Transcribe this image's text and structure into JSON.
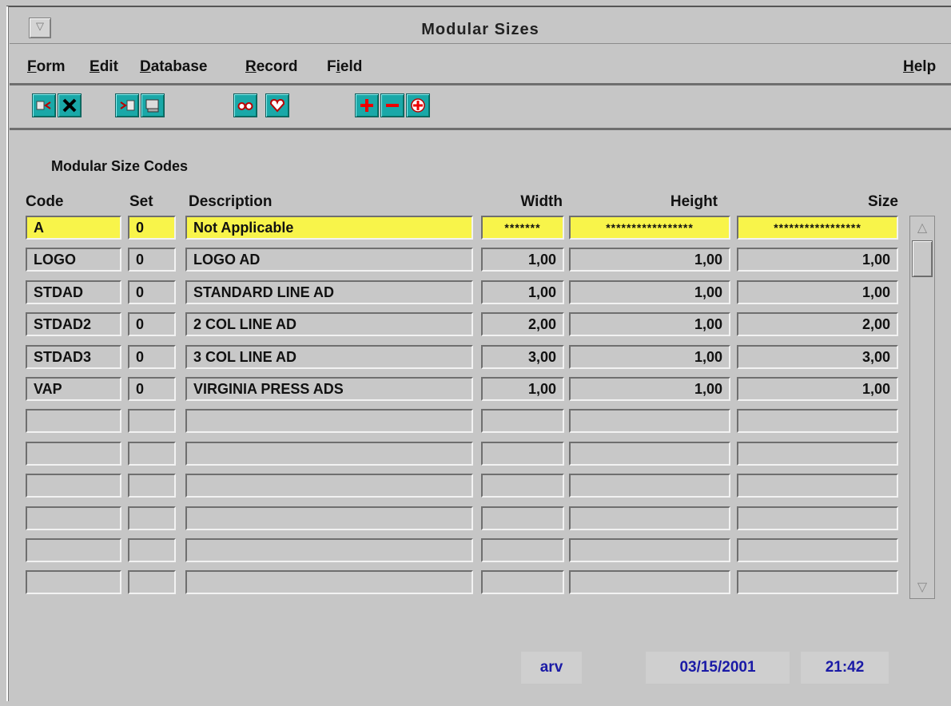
{
  "window": {
    "title": "Modular Sizes",
    "system_menu_glyph": "▽"
  },
  "menubar": {
    "items": [
      {
        "mnemonic": "F",
        "rest": "orm"
      },
      {
        "mnemonic": "E",
        "rest": "dit"
      },
      {
        "mnemonic": "D",
        "rest": "atabase"
      },
      {
        "mnemonic": "R",
        "rest": "ecord"
      },
      {
        "lead": "F",
        "mnemonic": "i",
        "rest": "eld"
      },
      {
        "mnemonic": "H",
        "rest": "elp"
      }
    ]
  },
  "toolbar": {
    "buttons": [
      {
        "icon": "enter-query-icon"
      },
      {
        "icon": "cancel-x-icon"
      },
      {
        "icon": "execute-query-icon"
      },
      {
        "icon": "print-screen-icon"
      },
      {
        "icon": "glasses-view-icon"
      },
      {
        "icon": "heart-favorite-icon"
      },
      {
        "icon": "plus-add-icon"
      },
      {
        "icon": "minus-delete-icon"
      },
      {
        "icon": "cross-duplicate-icon"
      }
    ],
    "icon_color": "#1aa8a8"
  },
  "form": {
    "section_label": "Modular Size Codes",
    "headers": {
      "code": "Code",
      "set": "Set",
      "description": "Description",
      "width": "Width",
      "height": "Height",
      "size": "Size"
    },
    "rows": [
      {
        "code": "A",
        "set": "0",
        "description": "Not Applicable",
        "width": "*******",
        "height": "*****************",
        "size": "*****************",
        "current": true
      },
      {
        "code": "LOGO",
        "set": "0",
        "description": "LOGO AD",
        "width": "1,00",
        "height": "1,00",
        "size": "1,00"
      },
      {
        "code": "STDAD",
        "set": "0",
        "description": "STANDARD LINE AD",
        "width": "1,00",
        "height": "1,00",
        "size": "1,00"
      },
      {
        "code": "STDAD2",
        "set": "0",
        "description": "2 COL LINE AD",
        "width": "2,00",
        "height": "1,00",
        "size": "2,00"
      },
      {
        "code": "STDAD3",
        "set": "0",
        "description": "3 COL LINE AD",
        "width": "3,00",
        "height": "1,00",
        "size": "3,00"
      },
      {
        "code": "VAP",
        "set": "0",
        "description": "VIRGINIA PRESS ADS",
        "width": "1,00",
        "height": "1,00",
        "size": "1,00"
      },
      {
        "code": "",
        "set": "",
        "description": "",
        "width": "",
        "height": "",
        "size": ""
      },
      {
        "code": "",
        "set": "",
        "description": "",
        "width": "",
        "height": "",
        "size": ""
      },
      {
        "code": "",
        "set": "",
        "description": "",
        "width": "",
        "height": "",
        "size": ""
      },
      {
        "code": "",
        "set": "",
        "description": "",
        "width": "",
        "height": "",
        "size": ""
      },
      {
        "code": "",
        "set": "",
        "description": "",
        "width": "",
        "height": "",
        "size": ""
      },
      {
        "code": "",
        "set": "",
        "description": "",
        "width": "",
        "height": "",
        "size": ""
      }
    ],
    "current_row_color": "#f8f44a"
  },
  "scrollbar": {
    "up_glyph": "△",
    "down_glyph": "▽"
  },
  "status": {
    "user": "arv",
    "date": "03/15/2001",
    "time": "21:42"
  }
}
